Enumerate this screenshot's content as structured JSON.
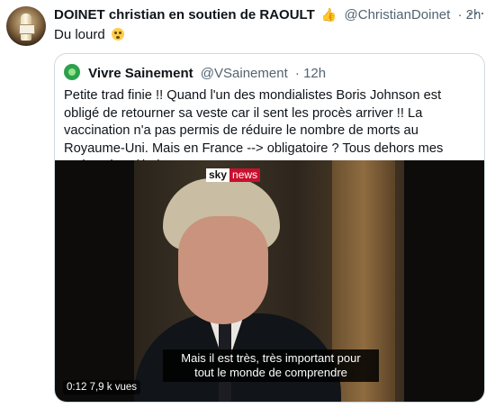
{
  "tweet": {
    "author_name": "DOINET christian en soutien de RAOULT",
    "author_emoji": "👍",
    "handle": "@ChristianDoinet",
    "time": "· 2h",
    "text": "Du lourd",
    "more": "···"
  },
  "quoted": {
    "author_name": "Vivre Sainement",
    "handle": "@VSainement",
    "time": "· 12h",
    "text": "Petite trad finie !! Quand l'un des mondialistes Boris Johnson est obligé de retourner sa veste car il sent les procès arriver !! La vaccination n'a pas permis de réduire le nombre de morts au Royaume-Uni. Mais en France --> obligatoire ? Tous dehors mes amis aujourd'hui !!",
    "video": {
      "logo_sky": "sky",
      "logo_news": "news",
      "subtitle_line1": "Mais il est très, très important pour",
      "subtitle_line2": "tout le monde de comprendre",
      "duration": "0:12",
      "views": "7,9 k vues"
    }
  }
}
